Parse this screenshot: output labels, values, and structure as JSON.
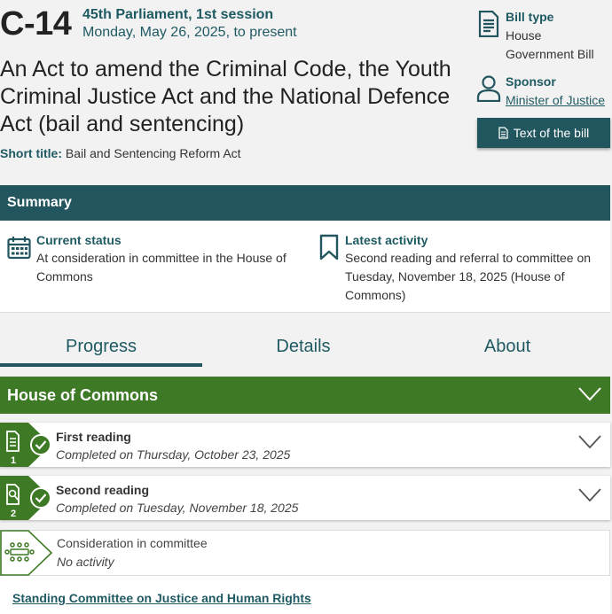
{
  "bill": {
    "number": "C-14",
    "session": "45th Parliament, 1st session",
    "dates": "Monday, May 26, 2025, to present",
    "long_title": "An Act to amend the Criminal Code, the Youth Criminal Justice Act and the National Defence Act (bail and sentencing)",
    "short_title_label": "Short title:",
    "short_title": "Bail and Sentencing Reform Act"
  },
  "meta": {
    "bill_type_label": "Bill type",
    "bill_type_line1": "House",
    "bill_type_line2": "Government Bill",
    "sponsor_label": "Sponsor",
    "sponsor_value": "Minister of Justice",
    "text_button": "Text of the bill"
  },
  "summary": {
    "heading": "Summary",
    "current_status_label": "Current status",
    "current_status_line1": "At consideration in committee in the House of",
    "current_status_line2": "Commons",
    "latest_activity_label": "Latest activity",
    "latest_activity_line1": "Second reading and referral to committee on",
    "latest_activity_line2": "Tuesday, November 18, 2025 (House of",
    "latest_activity_line3": "Commons)"
  },
  "tabs": [
    {
      "label": "Progress",
      "active": true
    },
    {
      "label": "Details",
      "active": false
    },
    {
      "label": "About",
      "active": false
    }
  ],
  "chamber": {
    "label": "House of Commons",
    "stages": [
      {
        "number": "1",
        "title": "First reading",
        "status": "Completed on Thursday, October 23, 2025",
        "completed": true
      },
      {
        "number": "2",
        "title": "Second reading",
        "status": "Completed on Tuesday, November 18, 2025",
        "completed": true
      },
      {
        "number": "",
        "title": "Consideration in committee",
        "status": "No activity",
        "completed": false
      }
    ],
    "committee_link": "Standing Committee on Justice and Human Rights"
  },
  "colors": {
    "teal": "#22555e",
    "green": "#3e7a25",
    "text_teal": "#1f5a63"
  },
  "icons": [
    "document-icon",
    "person-icon",
    "calendar-icon",
    "bookmark-icon",
    "chevron-down-icon",
    "check-circle-icon",
    "meeting-table-icon"
  ]
}
